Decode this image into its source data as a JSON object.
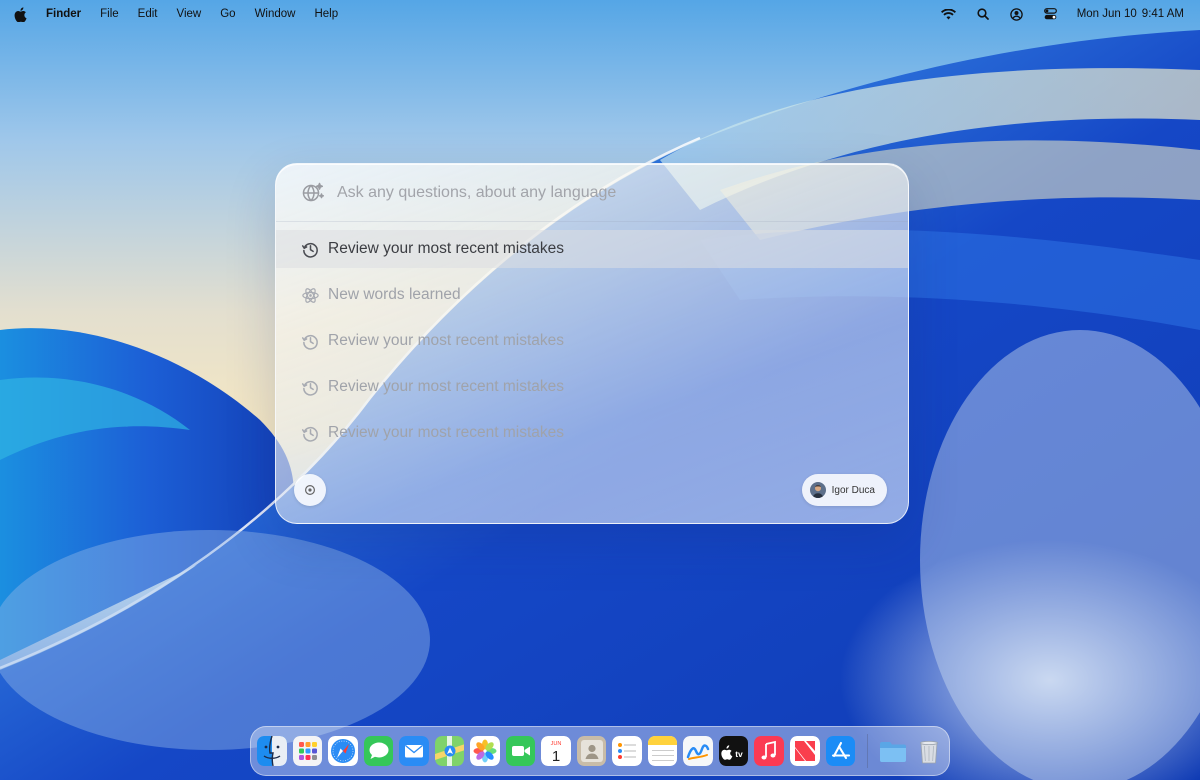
{
  "menubar": {
    "apple_icon": "apple-logo-icon",
    "app_name": "Finder",
    "menus": [
      "File",
      "Edit",
      "View",
      "Go",
      "Window",
      "Help"
    ],
    "status_icons": [
      "wifi-icon",
      "search-icon",
      "user-account-icon",
      "control-center-icon"
    ],
    "date": "Mon Jun 10",
    "time": "9:41 AM"
  },
  "panel": {
    "search_placeholder": "Ask any questions, about any language",
    "search_value": "",
    "search_icon": "translate-sparkle-icon",
    "items": [
      {
        "label": "Review your most recent mistakes",
        "icon": "history-icon",
        "selected": true
      },
      {
        "label": "New words learned",
        "icon": "atom-icon",
        "selected": false
      },
      {
        "label": "Review your most recent mistakes",
        "icon": "history-icon",
        "selected": false
      },
      {
        "label": "Review your most recent mistakes",
        "icon": "history-icon",
        "selected": false
      },
      {
        "label": "Review your most recent mistakes",
        "icon": "history-icon",
        "selected": false
      }
    ],
    "bottom_button_icon": "settings-icon",
    "user_name": "Igor Duca"
  },
  "dock": {
    "apps": [
      "Finder",
      "Launchpad",
      "Safari",
      "Messages",
      "Mail",
      "Maps",
      "Photos",
      "FaceTime",
      "Calendar",
      "Contacts",
      "Reminders",
      "Notes",
      "Freeform",
      "TV",
      "Music",
      "News",
      "App Store"
    ],
    "calendar_month": "JUN",
    "calendar_day": "1",
    "tv_label": "tv",
    "right_items": [
      "Downloads",
      "Trash"
    ]
  },
  "colors": {
    "wallpaper_blue": "#1d4fcf",
    "accent_blue": "#1a6cf2",
    "panel_text_active": "#3b3d42",
    "panel_text_muted": "#a0a3aa"
  }
}
